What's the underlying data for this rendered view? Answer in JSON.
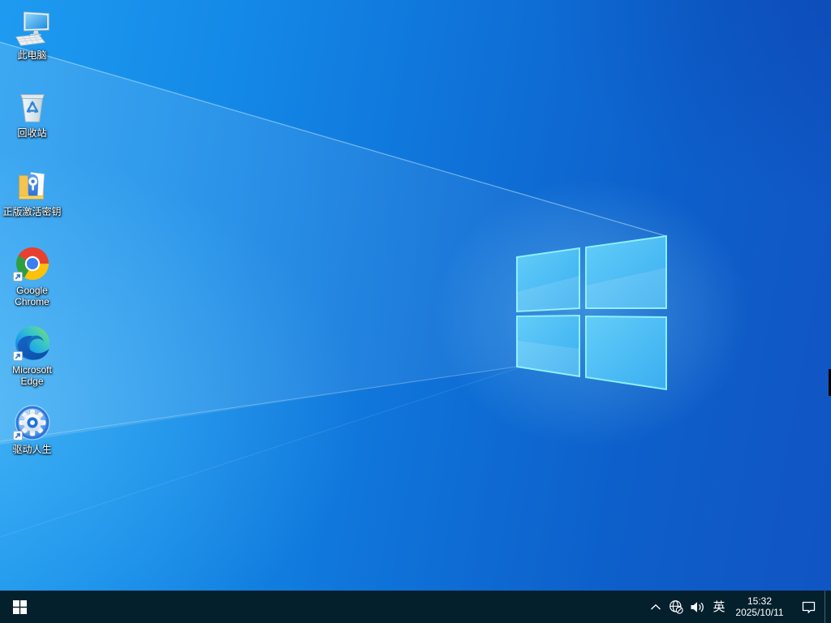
{
  "desktop": {
    "icons": [
      {
        "id": "this-pc",
        "label": "此电脑"
      },
      {
        "id": "recycle-bin",
        "label": "回收站"
      },
      {
        "id": "activation-key-folder",
        "label": "正版激活密钥"
      },
      {
        "id": "google-chrome",
        "label": "Google Chrome"
      },
      {
        "id": "microsoft-edge",
        "label": "Microsoft Edge"
      },
      {
        "id": "driver-life",
        "label": "驱动人生"
      }
    ]
  },
  "taskbar": {
    "start": {
      "icon": "windows-logo"
    },
    "tray": {
      "hidden_icons_icon": "chevron-up",
      "network_icon": "globe-no-internet",
      "volume_icon": "speaker-with-waves",
      "ime_language": "英",
      "clock": {
        "time": "15:32",
        "date": "2025/10/11"
      },
      "action_center_icon": "notification-bubble"
    }
  },
  "colors": {
    "taskbar_bg": "#05202d",
    "wallpaper_light": "#1e9bf0",
    "wallpaper_deep": "#1154c3",
    "flag_pane": "#4cbcf4",
    "flag_edge": "#8af0ff",
    "chrome_red": "#e8402f",
    "chrome_yellow": "#fdc107",
    "chrome_green": "#2f9e41",
    "chrome_blue": "#3b7ef0"
  }
}
